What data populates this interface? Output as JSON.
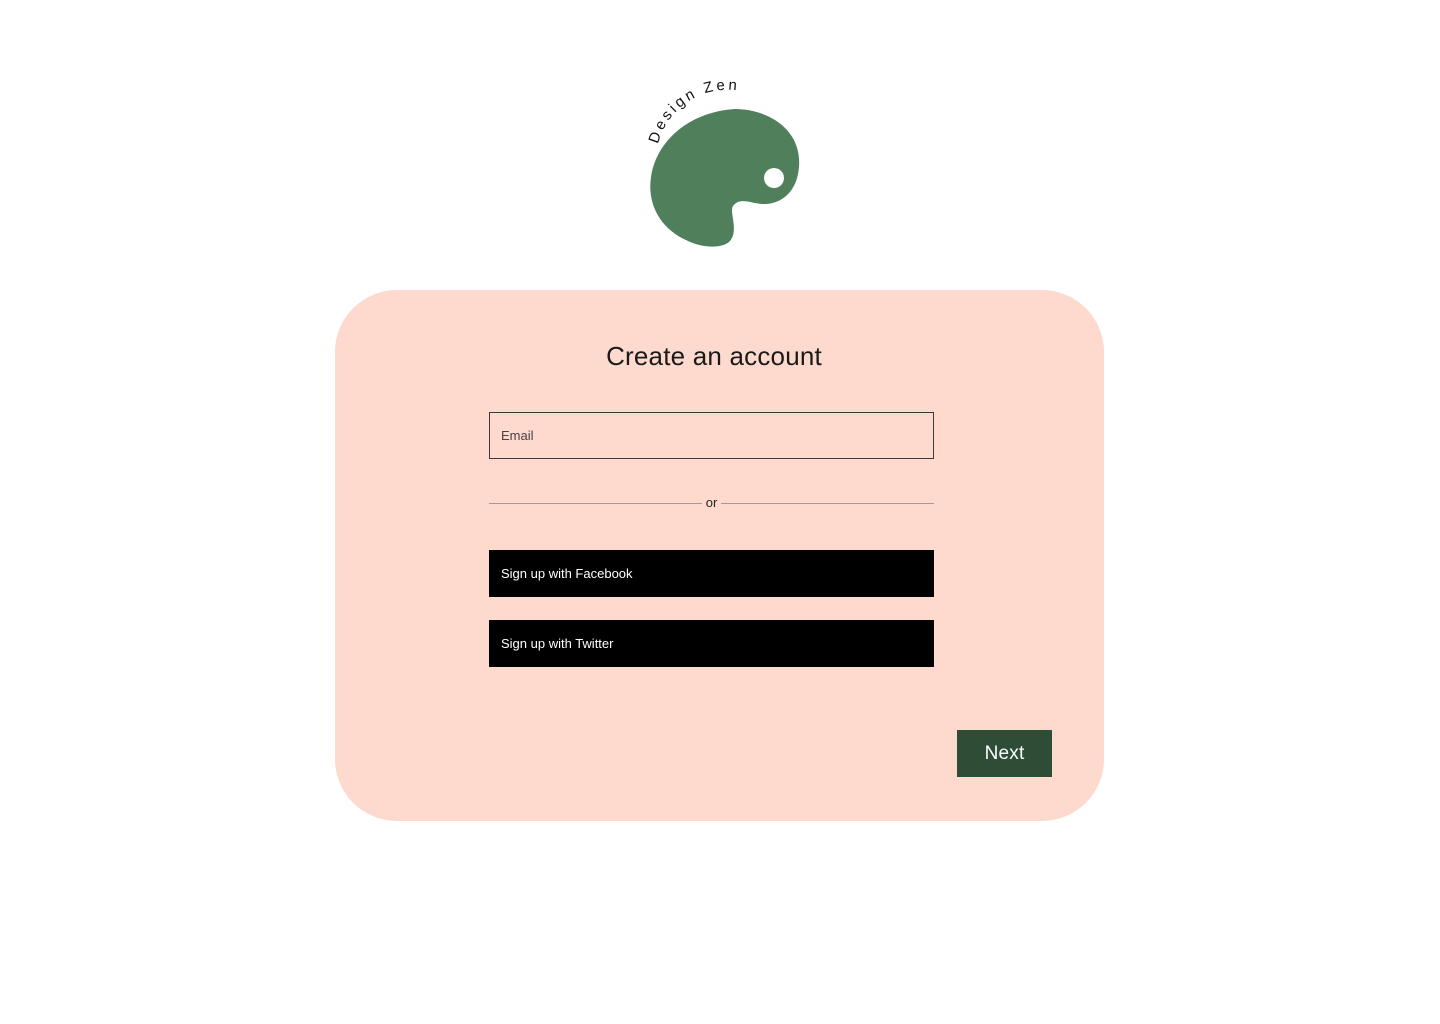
{
  "brand": {
    "logo_text": "Design Zen",
    "logo_color": "#4f7f5b",
    "logo_icon": "palette-icon"
  },
  "card": {
    "title": "Create an account",
    "background": "#fed9ce"
  },
  "email": {
    "placeholder": "Email",
    "value": ""
  },
  "divider": {
    "text": "or"
  },
  "social": {
    "facebook_label": "Sign up with Facebook",
    "twitter_label": "Sign up with Twitter"
  },
  "actions": {
    "next_label": "Next",
    "next_color": "#2e4d36"
  }
}
